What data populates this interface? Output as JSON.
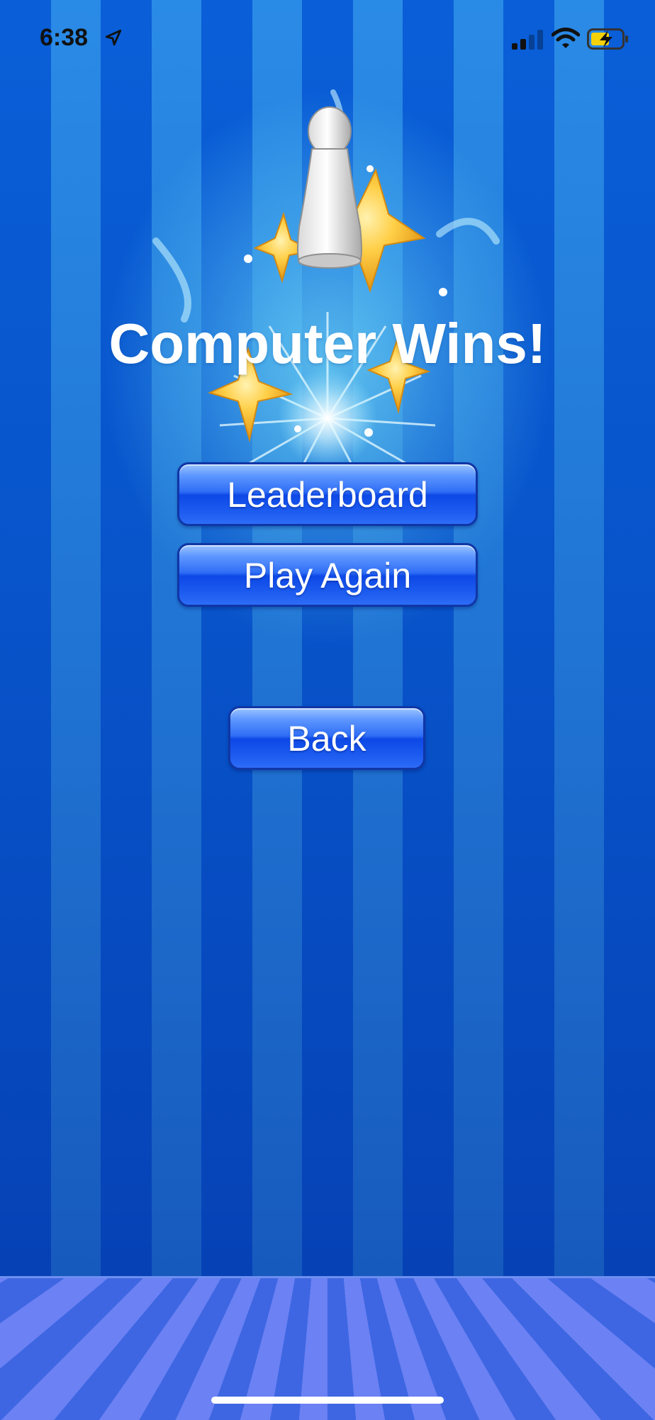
{
  "status_bar": {
    "time": "6:38",
    "icons": [
      "location-arrow-icon",
      "cellular-signal-icon",
      "wifi-icon",
      "battery-charging-icon"
    ]
  },
  "result": {
    "title": "Computer Wins!"
  },
  "buttons": {
    "leaderboard": "Leaderboard",
    "play_again": "Play Again",
    "back": "Back"
  },
  "colors": {
    "button_blue": "#1d5cf0",
    "background_blue": "#0a5fd8",
    "floor_blue": "#4f78e8",
    "star_gold": "#f7b72d"
  }
}
